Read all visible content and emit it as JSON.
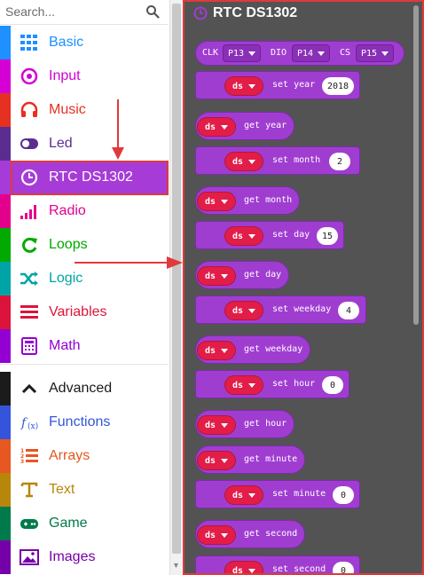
{
  "search": {
    "placeholder": "Search..."
  },
  "categories": [
    {
      "label": "Basic",
      "color": "#1e90ff",
      "icon": "grid-icon"
    },
    {
      "label": "Input",
      "color": "#d400d4",
      "icon": "target-icon"
    },
    {
      "label": "Music",
      "color": "#e63022",
      "icon": "headphones-icon"
    },
    {
      "label": "Led",
      "color": "#5c2d91",
      "icon": "toggle-icon"
    },
    {
      "label": "RTC DS1302",
      "color": "#a73bd7",
      "icon": "clock-icon"
    },
    {
      "label": "Radio",
      "color": "#e3008c",
      "icon": "signal-icon"
    },
    {
      "label": "Loops",
      "color": "#00aa00",
      "icon": "loop-icon"
    },
    {
      "label": "Logic",
      "color": "#00a4a6",
      "icon": "shuffle-icon"
    },
    {
      "label": "Variables",
      "color": "#dc143c",
      "icon": "lines-icon"
    },
    {
      "label": "Math",
      "color": "#9400d3",
      "icon": "calculator-icon"
    },
    {
      "label": "Advanced",
      "color": "#1b1b1b",
      "icon": "chevron-up-icon"
    },
    {
      "label": "Functions",
      "color": "#3455db",
      "icon": "function-icon"
    },
    {
      "label": "Arrays",
      "color": "#e65722",
      "icon": "list-numbered-icon"
    },
    {
      "label": "Text",
      "color": "#b8860b",
      "icon": "text-icon"
    },
    {
      "label": "Game",
      "color": "#007a4b",
      "icon": "gamepad-icon"
    },
    {
      "label": "Images",
      "color": "#7600a8",
      "icon": "image-icon"
    }
  ],
  "flyout": {
    "title": "RTC DS1302",
    "accent": "#a03dd1",
    "init_block": {
      "clk": "CLK",
      "clk_pin": "P13",
      "dio": "DIO",
      "dio_pin": "P14",
      "cs": "CS",
      "cs_pin": "P15"
    },
    "blocks": [
      {
        "kind": "set",
        "var": "ds",
        "text": "set year",
        "value": "2018"
      },
      {
        "kind": "get",
        "var": "ds",
        "text": "get year"
      },
      {
        "kind": "set",
        "var": "ds",
        "text": "set month",
        "value": "2"
      },
      {
        "kind": "get",
        "var": "ds",
        "text": "get month"
      },
      {
        "kind": "set",
        "var": "ds",
        "text": "set day",
        "value": "15"
      },
      {
        "kind": "get",
        "var": "ds",
        "text": "get day"
      },
      {
        "kind": "set",
        "var": "ds",
        "text": "set weekday",
        "value": "4"
      },
      {
        "kind": "get",
        "var": "ds",
        "text": "get weekday"
      },
      {
        "kind": "set",
        "var": "ds",
        "text": "set hour",
        "value": "0"
      },
      {
        "kind": "get",
        "var": "ds",
        "text": "get hour"
      },
      {
        "kind": "get",
        "var": "ds",
        "text": "get minute"
      },
      {
        "kind": "set",
        "var": "ds",
        "text": "set minute",
        "value": "0"
      },
      {
        "kind": "get",
        "var": "ds",
        "text": "get second"
      },
      {
        "kind": "set",
        "var": "ds",
        "text": "set second",
        "value": "0"
      }
    ]
  }
}
